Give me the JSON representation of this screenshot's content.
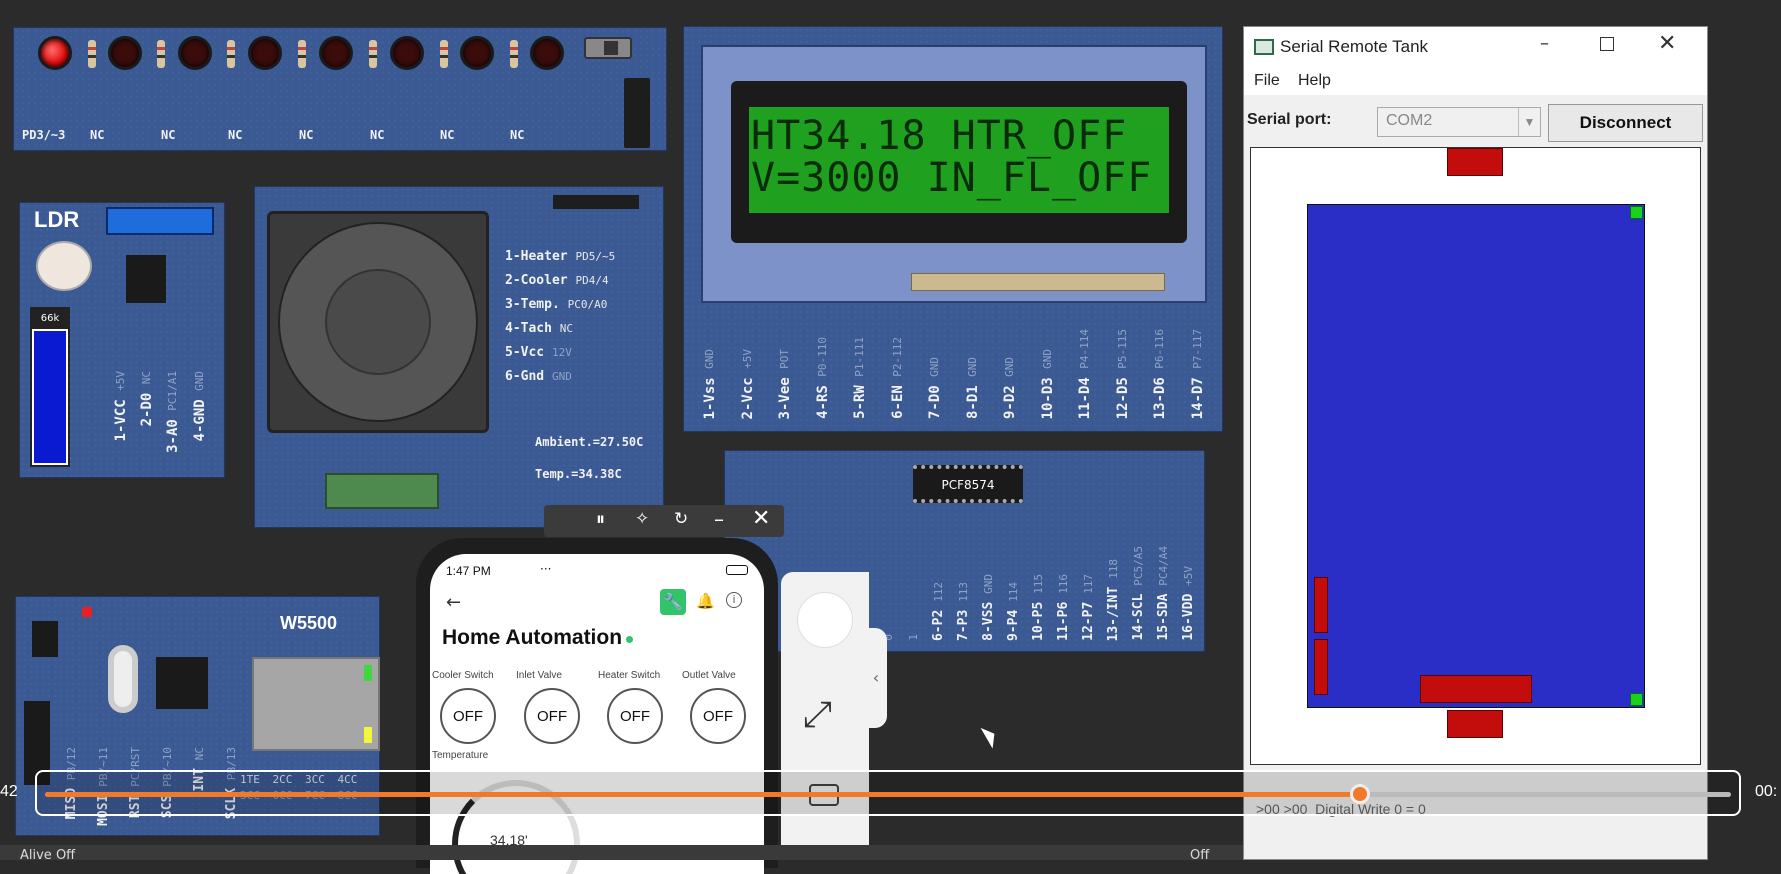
{
  "led_board": {
    "pin_labels": [
      "PD3/~3",
      "NC",
      "NC",
      "NC",
      "NC",
      "NC",
      "NC",
      "NC"
    ],
    "led_states": [
      true,
      false,
      false,
      false,
      false,
      false,
      false,
      false
    ]
  },
  "ldr_board": {
    "title": "LDR",
    "slider_value": "66k",
    "pins": [
      {
        "name": "1-VCC",
        "sub": "+5V"
      },
      {
        "name": "2-D0",
        "sub": "NC"
      },
      {
        "name": "3-A0",
        "sub": "PC1/A1"
      },
      {
        "name": "4-GND",
        "sub": "GND"
      }
    ]
  },
  "fan_board": {
    "pins": [
      {
        "name": "1-Heater",
        "sub": "PD5/~5"
      },
      {
        "name": "2-Cooler",
        "sub": "PD4/4"
      },
      {
        "name": "3-Temp.",
        "sub": "PC0/A0"
      },
      {
        "name": "4-Tach",
        "sub": "NC"
      },
      {
        "name": "5-Vcc",
        "sub": "12V"
      },
      {
        "name": "6-Gnd",
        "sub": "GND"
      }
    ],
    "ambient": "Ambient.=27.50C",
    "temp": "Temp.=34.38C"
  },
  "lcd": {
    "line1": "HT34.18 HTR_OFF",
    "line2": "V=3000 IN_FL_OFF",
    "pins": [
      {
        "name": "1-Vss",
        "sub": "GND"
      },
      {
        "name": "2-Vcc",
        "sub": "+5V"
      },
      {
        "name": "3-Vee",
        "sub": "POT"
      },
      {
        "name": "4-RS",
        "sub": "P0-110"
      },
      {
        "name": "5-RW",
        "sub": "P1-111"
      },
      {
        "name": "6-EN",
        "sub": "P2-112"
      },
      {
        "name": "7-D0",
        "sub": "GND"
      },
      {
        "name": "8-D1",
        "sub": "GND"
      },
      {
        "name": "9-D2",
        "sub": "GND"
      },
      {
        "name": "10-D3",
        "sub": "GND"
      },
      {
        "name": "11-D4",
        "sub": "P4-114"
      },
      {
        "name": "12-D5",
        "sub": "P5-115"
      },
      {
        "name": "13-D6",
        "sub": "P6-116"
      },
      {
        "name": "14-D7",
        "sub": "P7-117"
      }
    ]
  },
  "pcf": {
    "chip": "PCF8574",
    "pins": [
      {
        "name": "",
        "sub": "0"
      },
      {
        "name": "",
        "sub": "1"
      },
      {
        "name": "6-P2",
        "sub": "112"
      },
      {
        "name": "7-P3",
        "sub": "113"
      },
      {
        "name": "8-VSS",
        "sub": "GND"
      },
      {
        "name": "9-P4",
        "sub": "114"
      },
      {
        "name": "10-P5",
        "sub": "115"
      },
      {
        "name": "11-P6",
        "sub": "116"
      },
      {
        "name": "12-P7",
        "sub": "117"
      },
      {
        "name": "13-/INT",
        "sub": "118"
      },
      {
        "name": "14-SCL",
        "sub": "PC5/A5"
      },
      {
        "name": "15-SDA",
        "sub": "PC4/A4"
      },
      {
        "name": "16-VDD",
        "sub": "+5V"
      }
    ]
  },
  "w5500": {
    "title": "W5500",
    "pins": [
      "MISO",
      "MOSI",
      "RST",
      "SCS",
      "INT",
      "SCLK"
    ],
    "pins_sub": [
      "PB/12",
      "PB/~11",
      "PC/RST",
      "PB/~10",
      "NC",
      "PB/13"
    ],
    "leds_row1": [
      "1TE",
      "2CC",
      "3CC",
      "4CC"
    ],
    "leds_row2": [
      "3CC",
      "0CC",
      "7CC",
      "8CC"
    ]
  },
  "serial_window": {
    "title": "Serial Remote Tank",
    "menu": [
      "File",
      "Help"
    ],
    "serial_port_label": "Serial port:",
    "port": "COM2",
    "disconnect_label": "Disconnect",
    "log": ">00 >00  Digital Write 0 = 0"
  },
  "phone": {
    "time": "1:47 PM",
    "status_icons": "···",
    "title": "Home Automation",
    "controls": [
      {
        "label": "Cooler Switch",
        "value": "OFF"
      },
      {
        "label": "Inlet Valve",
        "value": "OFF"
      },
      {
        "label": "Heater Switch",
        "value": "OFF"
      },
      {
        "label": "Outlet Valve",
        "value": "OFF"
      }
    ],
    "temp_label": "Temperature",
    "gauge_value": "34.18'"
  },
  "player": {
    "time_left": "42",
    "time_right": "00:",
    "progress": 0.78
  },
  "bottom": {
    "text": "Alive Off",
    "right": "Off"
  },
  "colors": {
    "board": "#3b5a93",
    "lcd_bg": "#1fa11f",
    "tank": "#2b2ec6",
    "accent": "#f07a2a"
  }
}
